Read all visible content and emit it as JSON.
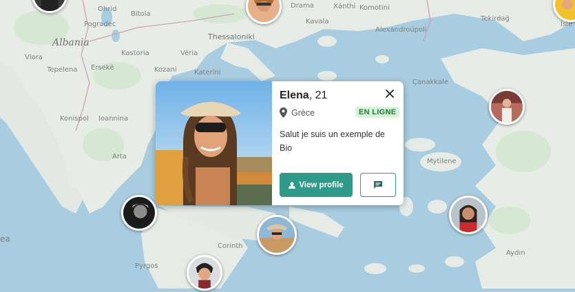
{
  "map": {
    "labels": {
      "country_albania": "Albania",
      "ohrid": "Ohrid",
      "bitola": "Bitola",
      "pogradec": "Pogradec",
      "vlora": "Vlora",
      "tepelena": "Tepelena",
      "erseke": "Ersekë",
      "kastoria": "Kastoria",
      "veria": "Véria",
      "kozani": "Kozani",
      "katerini": "Katerini",
      "thessaloniki": "Thessaloniki",
      "drama": "Drama",
      "xanthi": "Xánthi",
      "komotini": "Komotini",
      "kavala": "Kavala",
      "alexandroupoli": "Alexandroúpoli",
      "tekirdag": "Tekirdağ",
      "isle": "İsle",
      "konispol": "Konispol",
      "ioannina": "Ioannina",
      "arta": "Arta",
      "canakkale": "Çanakkale",
      "mytilene": "Mytilene",
      "corinth": "Corinth",
      "pyrgos": "Pyrgos",
      "aydin": "Aydın",
      "sea_fragment": "ea"
    }
  },
  "profile_card": {
    "name": "Elena",
    "age_text": ", 21",
    "location": "Grèce",
    "status_badge": "EN LIGNE",
    "bio": "Salut je suis un exemple de Bio",
    "view_profile_label": "View profile",
    "icons": {
      "close": "close-icon",
      "location": "location-pin-icon",
      "user": "user-icon",
      "message": "chat-bubble-icon"
    },
    "colors": {
      "primary": "#2f9a8a",
      "badge_bg": "#d6f4d8",
      "badge_text": "#1d7a3a"
    }
  },
  "markers": [
    {
      "name": "marker-user-top-left"
    },
    {
      "name": "marker-user-top-center"
    },
    {
      "name": "marker-user-top-right"
    },
    {
      "name": "marker-user-east"
    },
    {
      "name": "marker-user-west"
    },
    {
      "name": "marker-user-southwest"
    },
    {
      "name": "marker-user-selected-elena"
    },
    {
      "name": "marker-user-south"
    },
    {
      "name": "marker-user-southeast"
    }
  ]
}
